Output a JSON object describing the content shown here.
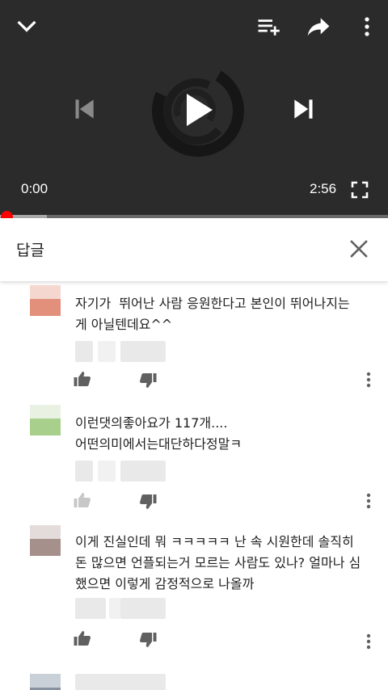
{
  "player": {
    "current_time": "0:00",
    "duration": "2:56",
    "progress_fraction": 0.0,
    "buffered_fraction": 0.12,
    "icons": [
      "chevron-down-icon",
      "add-to-queue-icon",
      "share-icon",
      "more-vert-icon",
      "skip-previous-icon",
      "play-icon",
      "skip-next-icon",
      "fullscreen-icon"
    ]
  },
  "replies": {
    "title": "답글",
    "close_icon": "close-icon"
  },
  "comments": [
    {
      "text": "자기가  뛰어난 사람 응원한다고 본인이 뛰어나지는\n게 아닐텐데요^^",
      "avatar_colors": [
        "#f4d7cf",
        "#e2907c",
        "#fbf4f2"
      ]
    },
    {
      "text": "이런댓의좋아요가 117개....\n어떤의미에서는대단하다정말ㅋ",
      "avatar_colors": [
        "#e9f2e2",
        "#a8d08c",
        "#f6f9f3"
      ]
    },
    {
      "text": "이게 진실인데 뭐 ㅋㅋㅋㅋㅋ 난 속 시원한데 솔직히\n돈 많으면 언플되는거 모르는 사람도 있나? 얼마나 심\n했으면 이렇게 감정적으로 나올까",
      "avatar_colors": [
        "#e3dcdb",
        "#a6908b",
        "#f5f2f1"
      ]
    },
    {
      "text": "",
      "avatar_colors": [
        "#c9d0d8",
        "#8792a1",
        "#eceff2"
      ]
    }
  ],
  "colors": {
    "player_bg": "#2b2b2b",
    "progress_red": "#ff0000",
    "text": "#212121",
    "icon_grey": "#606060"
  }
}
